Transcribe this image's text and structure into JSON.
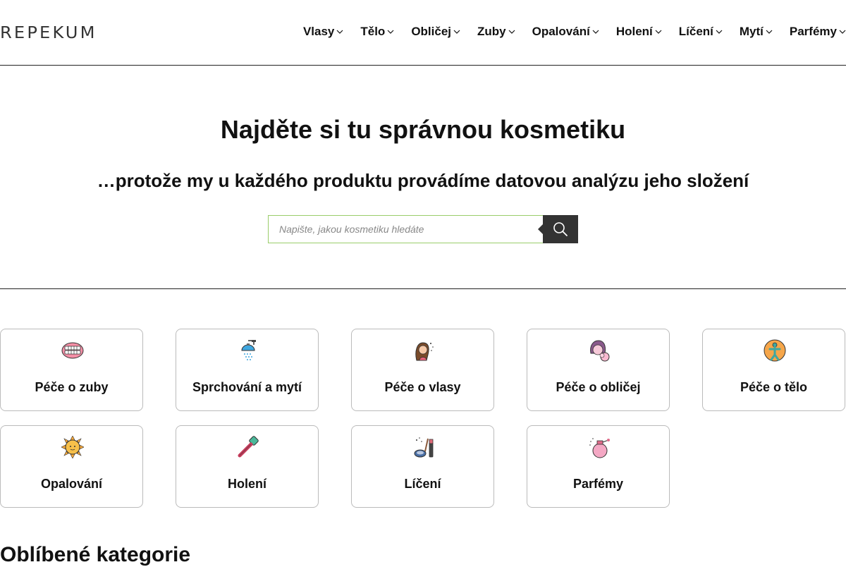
{
  "brand": {
    "logo_text": "REPEKUM"
  },
  "nav": {
    "items": [
      {
        "label": "Vlasy"
      },
      {
        "label": "Tělo"
      },
      {
        "label": "Obličej"
      },
      {
        "label": "Zuby"
      },
      {
        "label": "Opalování"
      },
      {
        "label": "Holení"
      },
      {
        "label": "Líčení"
      },
      {
        "label": "Mytí"
      },
      {
        "label": "Parfémy"
      }
    ]
  },
  "hero": {
    "title": "Najděte si tu správnou kosmetiku",
    "subtitle": "…protože my u každého produktu provádíme datovou analýzu jeho složení"
  },
  "search": {
    "placeholder": "Napište, jakou kosmetiku hledáte",
    "value": "",
    "icon": "search-icon"
  },
  "categories": [
    {
      "label": "Péče o zuby",
      "icon": "teeth-icon"
    },
    {
      "label": "Sprchování a mytí",
      "icon": "shower-icon"
    },
    {
      "label": "Péče o vlasy",
      "icon": "hair-woman-icon"
    },
    {
      "label": "Péče o obličej",
      "icon": "face-care-icon"
    },
    {
      "label": "Péče o tělo",
      "icon": "body-icon"
    },
    {
      "label": "Opalování",
      "icon": "sun-icon"
    },
    {
      "label": "Holení",
      "icon": "razor-icon"
    },
    {
      "label": "Líčení",
      "icon": "makeup-icon"
    },
    {
      "label": "Parfémy",
      "icon": "perfume-icon"
    }
  ],
  "sections": {
    "favorites_title": "Oblíbené kategorie"
  }
}
